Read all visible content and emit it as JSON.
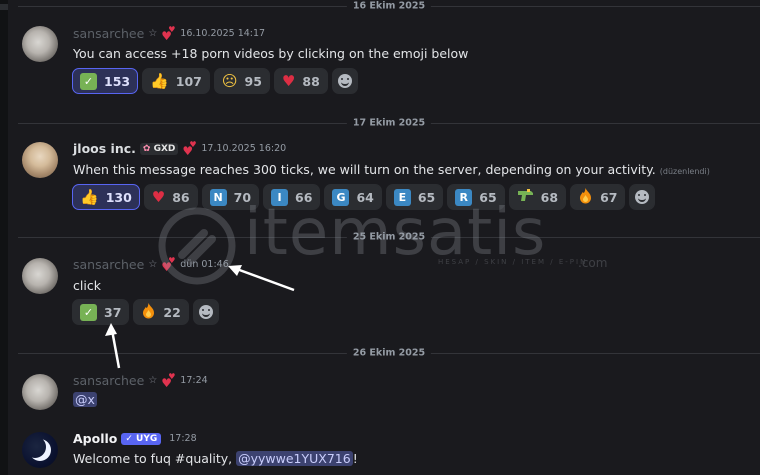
{
  "dividers": {
    "d1": "16 Ekim 2025",
    "d2": "17 Ekim 2025",
    "d3": "25 Ekim 2025",
    "d4": "26 Ekim 2025"
  },
  "messages": [
    {
      "username": "sansarchee",
      "star": "☆",
      "timestamp": "16.10.2025 14:17",
      "text": "You can access +18 porn videos by clicking on the emoji below",
      "reactions": [
        {
          "emoji": "check-mark-button",
          "count": "153",
          "active": true
        },
        {
          "emoji": "thumbs-up",
          "count": "107"
        },
        {
          "emoji": "pleading-face",
          "count": "95"
        },
        {
          "emoji": "red-heart",
          "count": "88"
        }
      ]
    },
    {
      "username": "jloos inc.",
      "tag": "GXD",
      "timestamp": "17.10.2025 16:20",
      "text": "When this message reaches 300 ticks, we will turn on the server, depending on your activity.",
      "edited": "(düzenlendi)",
      "reactions": [
        {
          "emoji": "thumbs-up",
          "count": "130",
          "active": true
        },
        {
          "emoji": "red-heart",
          "count": "86"
        },
        {
          "emoji": "regional-n",
          "letter": "N",
          "count": "70"
        },
        {
          "emoji": "regional-i",
          "letter": "I",
          "count": "66"
        },
        {
          "emoji": "regional-g",
          "letter": "G",
          "count": "64"
        },
        {
          "emoji": "regional-e",
          "letter": "E",
          "count": "65"
        },
        {
          "emoji": "regional-r",
          "letter": "R",
          "count": "65"
        },
        {
          "emoji": "water-pistol",
          "count": "68"
        },
        {
          "emoji": "fire",
          "count": "67"
        }
      ]
    },
    {
      "username": "sansarchee",
      "star": "☆",
      "timestamp": "dün 01:46",
      "text": "click",
      "reactions": [
        {
          "emoji": "check-mark-button",
          "count": "37"
        },
        {
          "emoji": "fire",
          "count": "22"
        }
      ]
    },
    {
      "username": "sansarchee",
      "star": "☆",
      "timestamp": "17:24",
      "mention": "@x"
    },
    {
      "username": "Apollo",
      "app_badge": "✓ UYG",
      "timestamp": "17:28",
      "text_prefix": "Welcome to fuq #quality, ",
      "mention": "@yywwe1YUX716",
      "text_suffix": "!"
    }
  ],
  "watermark": {
    "brand": "itemsatis",
    "tagline": "HESAP / SKIN / ITEM / E-PIN",
    "domain": ".com"
  },
  "colors": {
    "background": "#1a1a1e",
    "active_reaction_border": "#5865f2",
    "active_reaction_bg": "#2d3158",
    "reaction_bg": "#2b2d31",
    "regional_blue": "#3b88c3",
    "mention_bg": "#3c4270",
    "heart": "#e0334f",
    "check_green": "#77b255"
  }
}
